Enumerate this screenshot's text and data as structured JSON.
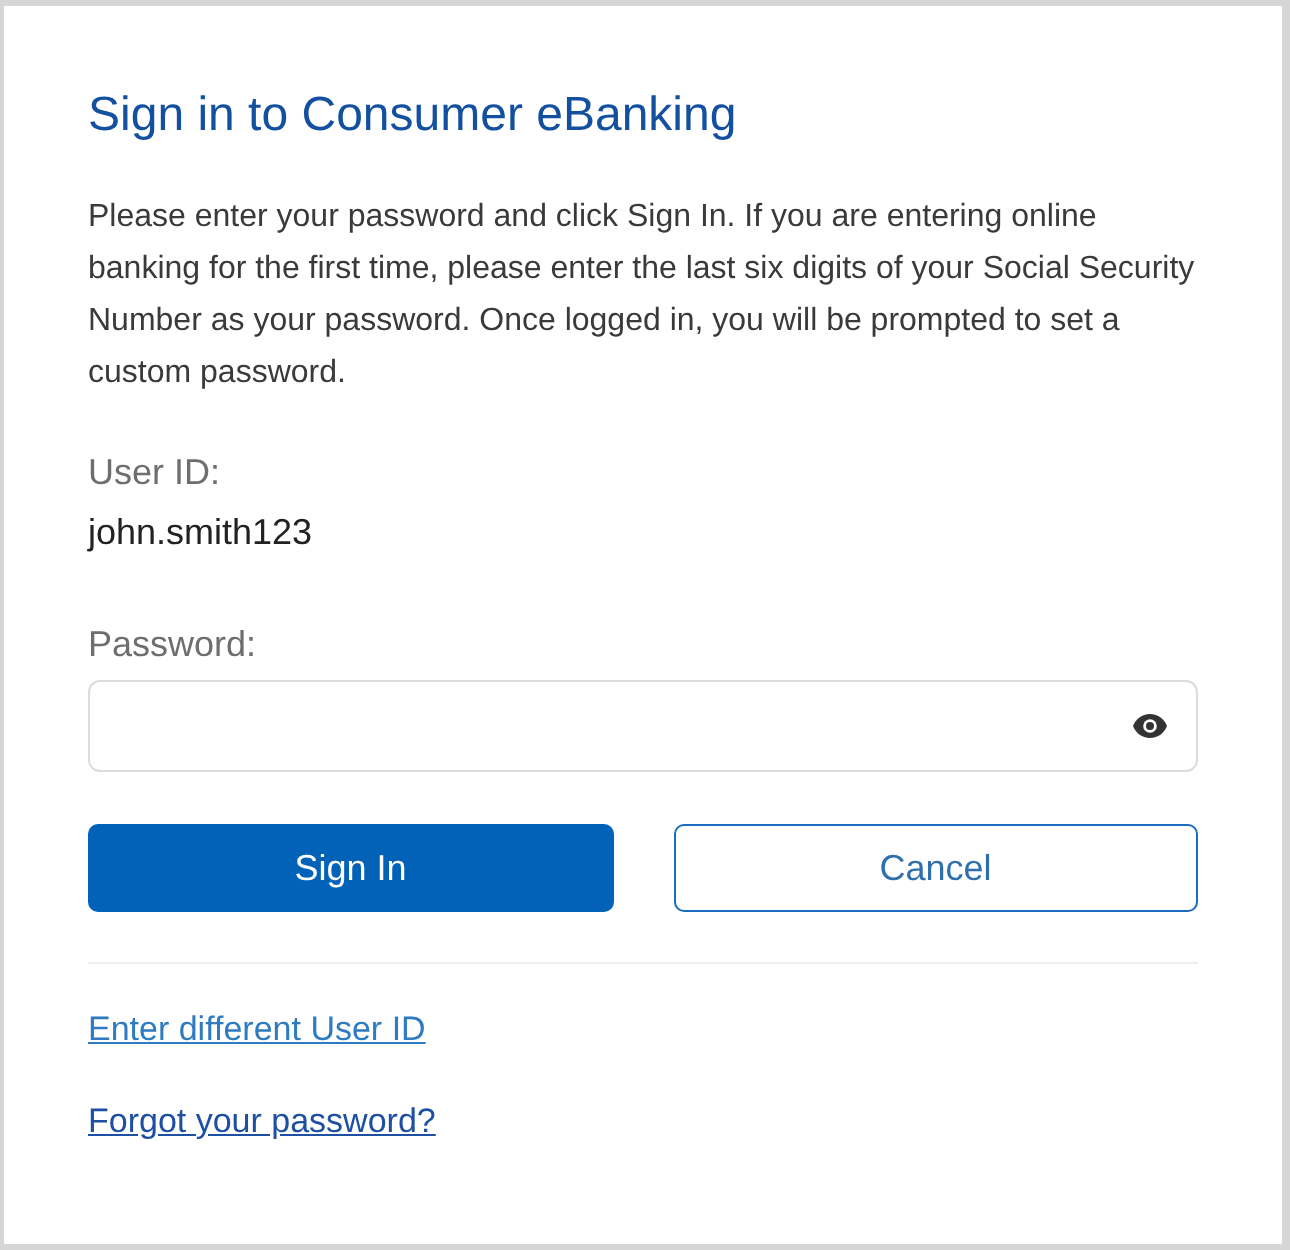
{
  "title": "Sign in to Consumer eBanking",
  "instructions": "Please enter your password and click Sign In. If you are entering online banking for the first time, please enter the last six digits of your Social Security Number as your password. Once logged in, you will be prompted to set a custom password.",
  "user_id": {
    "label": "User ID:",
    "value": "john.smith123"
  },
  "password": {
    "label": "Password:"
  },
  "buttons": [
    {
      "label": "Sign In",
      "kind": "primary"
    },
    {
      "label": "Cancel",
      "kind": "secondary"
    }
  ],
  "links": [
    {
      "label": "Enter different User ID",
      "color": "#2f7bbf"
    },
    {
      "label": "Forgot your password?",
      "color": "#1d4fa3"
    }
  ]
}
